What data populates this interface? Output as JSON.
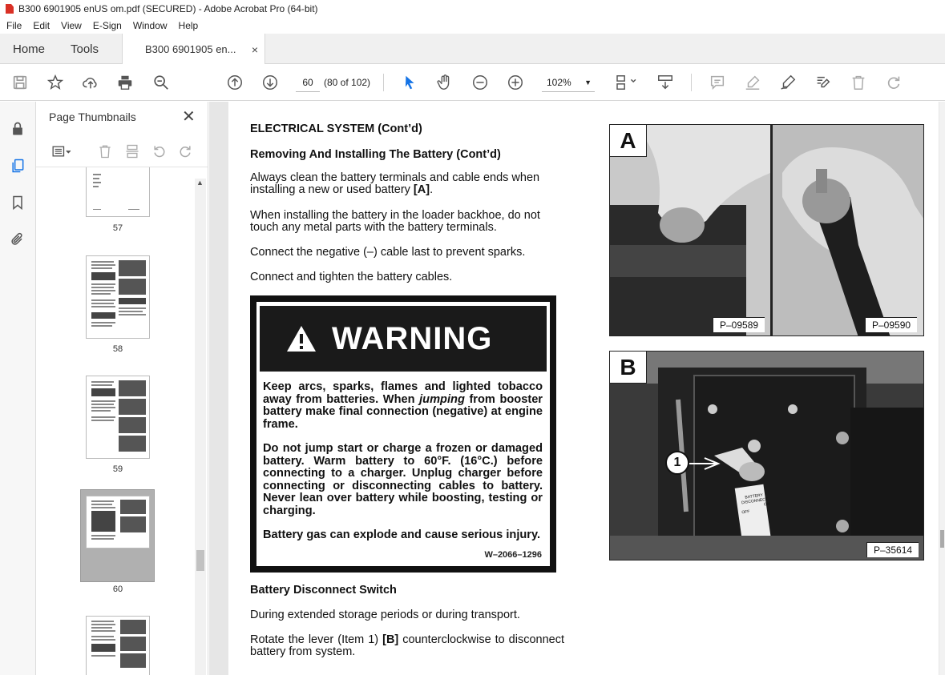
{
  "window": {
    "title": "B300 6901905 enUS om.pdf (SECURED) - Adobe Acrobat Pro (64-bit)"
  },
  "menu": [
    "File",
    "Edit",
    "View",
    "E-Sign",
    "Window",
    "Help"
  ],
  "tabs": {
    "home": "Home",
    "tools": "Tools",
    "doc": "B300 6901905 en...",
    "close": "×"
  },
  "toolbar": {
    "page_input": "60",
    "page_count": "(80 of 102)",
    "zoom": "102%"
  },
  "panel": {
    "title": "Page Thumbnails",
    "close": "✕",
    "thumbs": [
      {
        "label": "57"
      },
      {
        "label": "58"
      },
      {
        "label": "59"
      },
      {
        "label": "60"
      }
    ]
  },
  "doc": {
    "heading1": "ELECTRICAL SYSTEM (Cont’d)",
    "heading2": "Removing And Installing The Battery (Cont’d)",
    "p1": "Always clean the battery terminals and cable ends when installing a new or used battery ",
    "p1_ref": "[A]",
    "p1_end": ".",
    "p2": "When installing the battery in the loader backhoe, do not touch any metal parts with the battery terminals.",
    "p3": "Connect the negative (–) cable last to prevent sparks.",
    "p4": "Connect and tighten the battery cables.",
    "warning": {
      "title": "WARNING",
      "p1a": "Keep arcs, sparks, flames and lighted tobacco away from batteries. When ",
      "p1_italic": "jumping",
      "p1b": " from booster battery make final connection (negative) at engine frame.",
      "p2": "Do not jump start or charge a frozen or damaged battery. Warm battery to 60°F. (16°C.) before connecting to a charger. Unplug charger before connecting or disconnecting cables to battery. Never lean over battery while boosting, testing or charging.",
      "p3": "Battery gas can explode and cause serious injury.",
      "code": "W–2066–1296"
    },
    "heading3": "Battery Disconnect Switch",
    "p5": "During extended storage periods or during transport.",
    "p6a": "Rotate the lever (Item 1) ",
    "p6_ref": "[B]",
    "p6b": " counterclockwise to disconnect battery from system."
  },
  "photos": {
    "a_letter": "A",
    "a_code1": "P–09589",
    "a_code2": "P–09590",
    "b_letter": "B",
    "b_code": "P–35614",
    "b_callout": "1",
    "b_decal1": "BATTERY",
    "b_decal2": "DISCONNECT",
    "b_decal3": "ON",
    "b_decal4": "OFF"
  }
}
